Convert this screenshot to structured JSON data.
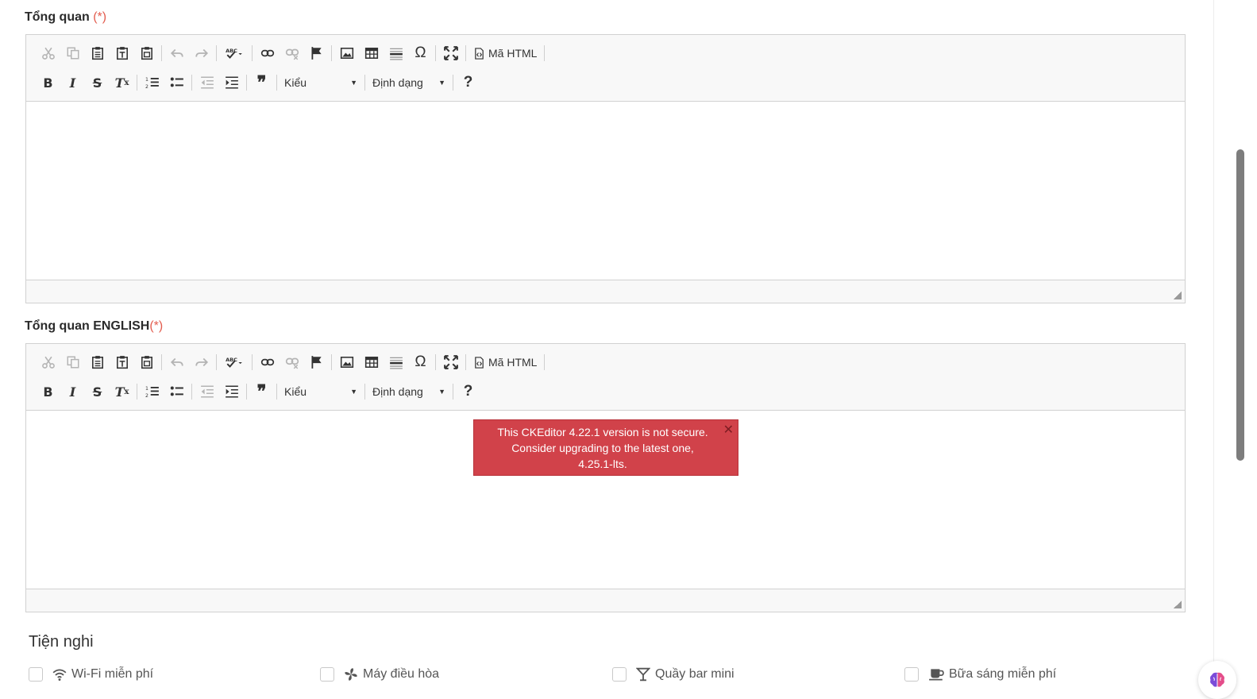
{
  "fields": [
    {
      "label": "Tổng quan",
      "required_mark": " (*)",
      "notification": null
    },
    {
      "label": "Tổng quan ENGLISH",
      "required_mark": "(*)",
      "notification": {
        "text": "This CKEditor 4.22.1 version is not secure. Consider upgrading to the latest one, 4.25.1-lts.",
        "close": "✕"
      }
    }
  ],
  "toolbar": {
    "source_label": "Mã HTML",
    "styles_label": "Kiểu",
    "format_label": "Định dạng",
    "help_label": "?",
    "bold": "B",
    "italic": "I",
    "strike": "S",
    "clear_main": "T",
    "clear_sub": "x",
    "blockquote": "❞",
    "special_char": "Ω",
    "caret": "▼"
  },
  "amenities": {
    "title": "Tiện nghi",
    "items": [
      {
        "label": "Wi-Fi miễn phí",
        "icon": "wifi-icon"
      },
      {
        "label": "Máy điều hòa",
        "icon": "fan-icon"
      },
      {
        "label": "Quầy bar mini",
        "icon": "cocktail-icon"
      },
      {
        "label": "Bữa sáng miễn phí",
        "icon": "coffee-icon"
      }
    ]
  },
  "colors": {
    "required": "#e35d4f",
    "notification_bg": "#d1424a",
    "scroll_thumb": "#7d7d7d"
  }
}
